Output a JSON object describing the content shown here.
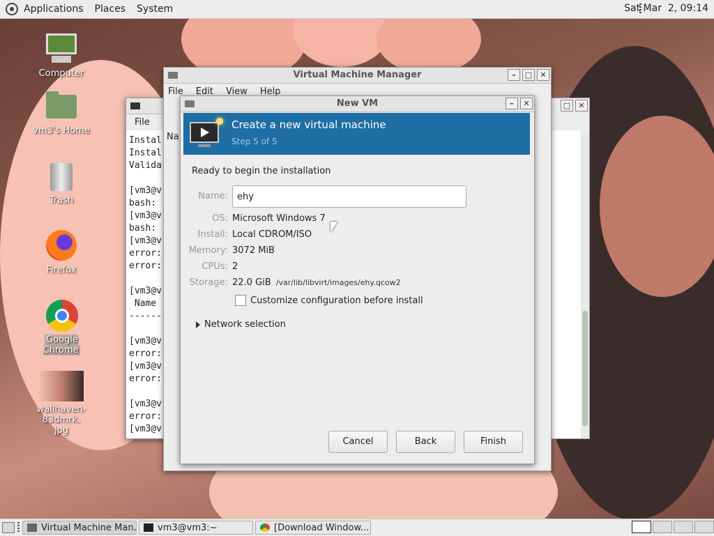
{
  "top_panel": {
    "menus": [
      "Applications",
      "Places",
      "System"
    ],
    "clock": "Sat Mar  2, 09:14"
  },
  "desktop_icons": [
    {
      "label": "Computer",
      "icon": "computer-icon"
    },
    {
      "label": "vm3's Home",
      "icon": "home-folder-icon"
    },
    {
      "label": "Trash",
      "icon": "trash-icon"
    },
    {
      "label": "Firefox",
      "icon": "firefox-icon"
    },
    {
      "label": "Google Chrome",
      "icon": "chrome-icon"
    },
    {
      "label": "wallhaven-83dmrk.\njpg",
      "icon": "image-file-icon"
    }
  ],
  "terminal": {
    "menu_file": "File",
    "lines": [
      "Instal",
      "Instal",
      "Valida",
      "",
      "[vm3@v",
      "bash:",
      "[vm3@v",
      "bash:",
      "[vm3@v",
      "error:",
      "error:",
      "",
      "[vm3@v",
      " Name",
      "------",
      "",
      "[vm3@v",
      "error:",
      "[vm3@v",
      "error:",
      "",
      "[vm3@v",
      "error:",
      "[vm3@v"
    ]
  },
  "vmm": {
    "title": "Virtual Machine Manager",
    "menus": [
      "File",
      "Edit",
      "View",
      "Help"
    ],
    "column_partial": "Na"
  },
  "dialog": {
    "title": "New VM",
    "banner_title": "Create a new virtual machine",
    "banner_step": "Step 5 of 5",
    "ready": "Ready to begin the installation",
    "name_label": "Name:",
    "name_value": "ehy",
    "os_label": "OS:",
    "os_value": "Microsoft Windows 7",
    "install_label": "Install:",
    "install_value": "Local CDROM/ISO",
    "memory_label": "Memory:",
    "memory_value": "3072 MiB",
    "cpus_label": "CPUs:",
    "cpus_value": "2",
    "storage_label": "Storage:",
    "storage_value": "22.0 GiB",
    "storage_path": "/var/lib/libvirt/images/ehy.qcow2",
    "customize_label": "Customize configuration before install",
    "customize_checked": false,
    "network_label": "Network selection",
    "cancel": "Cancel",
    "back": "Back",
    "finish": "Finish"
  },
  "taskbar": {
    "tasks": [
      {
        "label": "Virtual Machine Man...",
        "active": true
      },
      {
        "label": "vm3@vm3:~",
        "active": false
      },
      {
        "label": "[Download Window...",
        "active": false
      }
    ]
  }
}
